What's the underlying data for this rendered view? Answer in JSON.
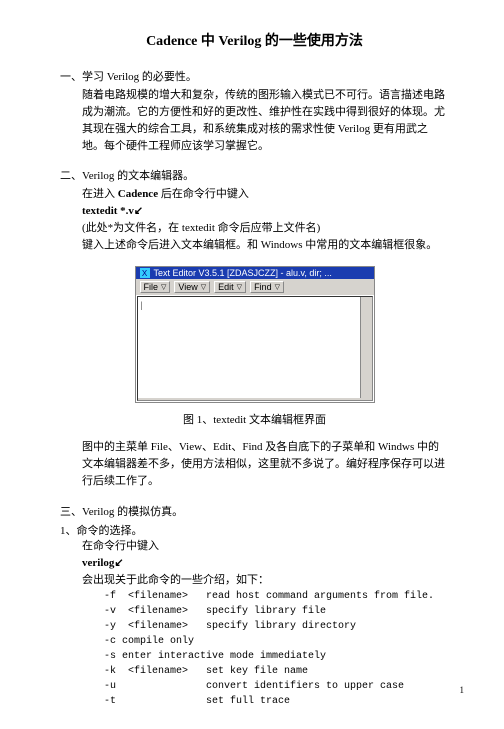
{
  "title": "Cadence 中 Verilog  的一些使用方法",
  "sec1": {
    "head": "一、学习 Verilog  的必要性。",
    "body": "随着电路规模的增大和复杂，传统的图形输入模式已不可行。语言描述电路成为潮流。它的方便性和好的更改性、维护性在实践中得到很好的体现。尤其现在强大的综合工具，和系统集成对核的需求性使 Verilog 更有用武之地。每个硬件工程师应该学习掌握它。"
  },
  "sec2": {
    "head": "二、Verilog  的文本编辑器。",
    "l1a": "在进入 ",
    "l1b": "Cadence",
    "l1c": " 后在命令行中键入",
    "l2": "textedit  *.v↙",
    "l3": "(此处*为文件名，在 textedit  命令后应带上文件名)",
    "l4": "键入上述命令后进入文本编辑框。和 Windows 中常用的文本编辑框很象。"
  },
  "editor": {
    "titlebar": "Text Editor V3.5.1  [ZDASJCZZ] - alu.v, dir; ...",
    "menus": {
      "file": "File",
      "view": "View",
      "edit": "Edit",
      "find": "Find"
    },
    "arrow": "▽",
    "cursor": "|"
  },
  "figcap": "图 1、textedit 文本编辑框界面",
  "sec2b": "图中的主菜单 File、View、Edit、Find 及各自底下的子菜单和 Windws 中的文本编辑器差不多，使用方法相似，这里就不多说了。编好程序保存可以进行后续工作了。",
  "sec3": {
    "head": "三、Verilog  的模拟仿真。",
    "sub": "1、命令的选择。",
    "l1": "在命令行中键入",
    "l2": "verilog↙",
    "l3": "会出现关于此命令的一些介绍，如下："
  },
  "opts": [
    "-f  <filename>   read host command arguments from file.",
    "-v  <filename>   specify library file",
    "-y  <filename>   specify library directory",
    "-c compile only",
    "-s enter interactive mode immediately",
    "-k  <filename>   set key file name",
    "-u               convert identifiers to upper case",
    "-t               set full trace"
  ],
  "pagenum": "1"
}
